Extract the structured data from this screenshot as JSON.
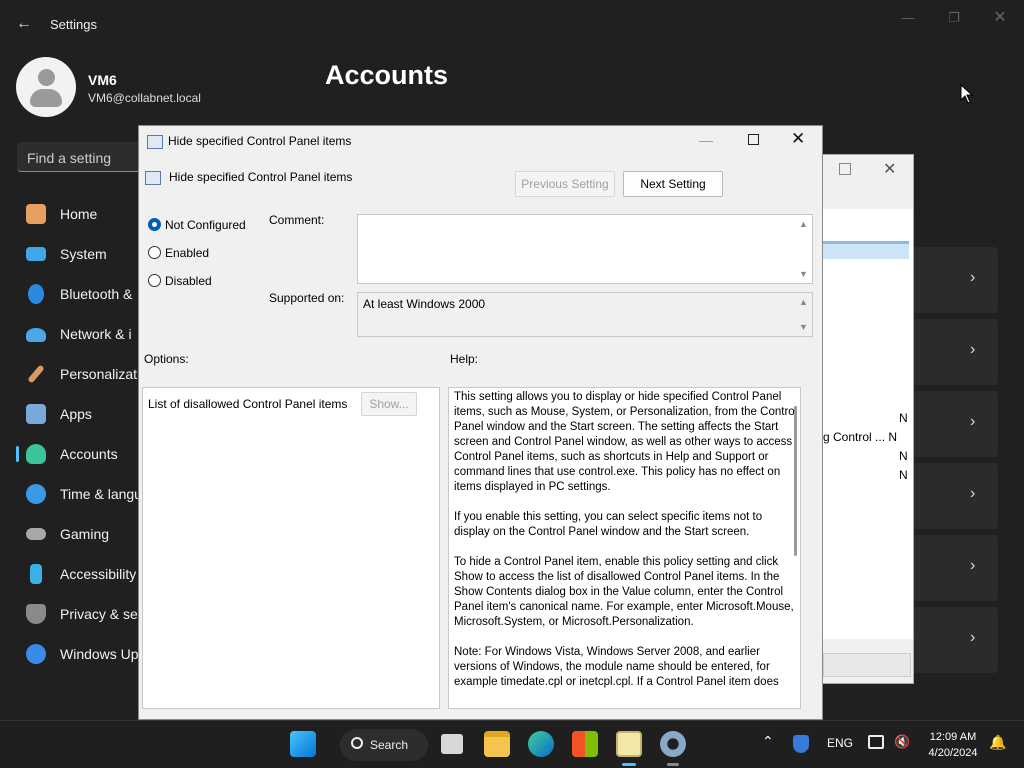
{
  "settings": {
    "app_title": "Settings",
    "user": {
      "name": "VM6",
      "email": "VM6@collabnet.local"
    },
    "page_title": "Accounts",
    "search_placeholder": "Find a setting",
    "nav": [
      {
        "label": "Home",
        "icon": "home-icon",
        "color": "#e8a060"
      },
      {
        "label": "System",
        "icon": "monitor-icon",
        "color": "#3fa8e8"
      },
      {
        "label": "Bluetooth &",
        "icon": "bluetooth-icon",
        "color": "#2a8ae0"
      },
      {
        "label": "Network & i",
        "icon": "wifi-icon",
        "color": "#4aa8e8"
      },
      {
        "label": "Personalizati",
        "icon": "brush-icon",
        "color": "#d89a60"
      },
      {
        "label": "Apps",
        "icon": "apps-icon",
        "color": "#7aa8d8"
      },
      {
        "label": "Accounts",
        "icon": "person-icon",
        "color": "#3cc39a",
        "active": true
      },
      {
        "label": "Time & langu",
        "icon": "globe-clock-icon",
        "color": "#3a9ae8"
      },
      {
        "label": "Gaming",
        "icon": "gamepad-icon",
        "color": "#a8a8a8"
      },
      {
        "label": "Accessibility",
        "icon": "accessibility-icon",
        "color": "#3ab0e8"
      },
      {
        "label": "Privacy & sec",
        "icon": "shield-icon",
        "color": "#8a8a8a"
      },
      {
        "label": "Windows Up",
        "icon": "sync-icon",
        "color": "#3a8ae8"
      }
    ]
  },
  "background_dialog": {
    "rows": [
      {
        "text": "N"
      },
      {
        "text": "g Control ...     N"
      },
      {
        "text": "N"
      },
      {
        "text": "N"
      }
    ]
  },
  "policy_dialog": {
    "window_title": "Hide specified Control Panel items",
    "heading": "Hide specified Control Panel items",
    "prev_button": "Previous Setting",
    "next_button": "Next Setting",
    "options": [
      {
        "label": "Not Configured",
        "checked": true
      },
      {
        "label": "Enabled",
        "checked": false
      },
      {
        "label": "Disabled",
        "checked": false
      }
    ],
    "comment_label": "Comment:",
    "comment_value": "",
    "supported_label": "Supported on:",
    "supported_value": "At least Windows 2000",
    "options_label": "Options:",
    "help_label": "Help:",
    "option_item_label": "List of disallowed Control Panel items",
    "show_button": "Show...",
    "help_text": "This setting allows you to display or hide specified Control Panel items, such as Mouse, System, or Personalization, from the Control Panel window and the Start screen. The setting affects the Start screen and Control Panel window, as well as other ways to access Control Panel items, such as shortcuts in Help and Support or command lines that use control.exe. This policy has no effect on items displayed in PC settings.\n\nIf you enable this setting, you can select specific items not to display on the Control Panel window and the Start screen.\n\nTo hide a Control Panel item, enable this policy setting and click Show to access the list of disallowed Control Panel items. In the Show Contents dialog box in the Value column, enter the Control Panel item's canonical name. For example, enter Microsoft.Mouse, Microsoft.System, or Microsoft.Personalization.\n\nNote: For Windows Vista, Windows Server 2008, and earlier versions of Windows, the module name should be entered, for example timedate.cpl or inetcpl.cpl. If a Control Panel item does"
  },
  "taskbar": {
    "search_label": "Search",
    "language": "ENG",
    "time": "12:09 AM",
    "date": "4/20/2024",
    "accent": "#0078d4"
  }
}
